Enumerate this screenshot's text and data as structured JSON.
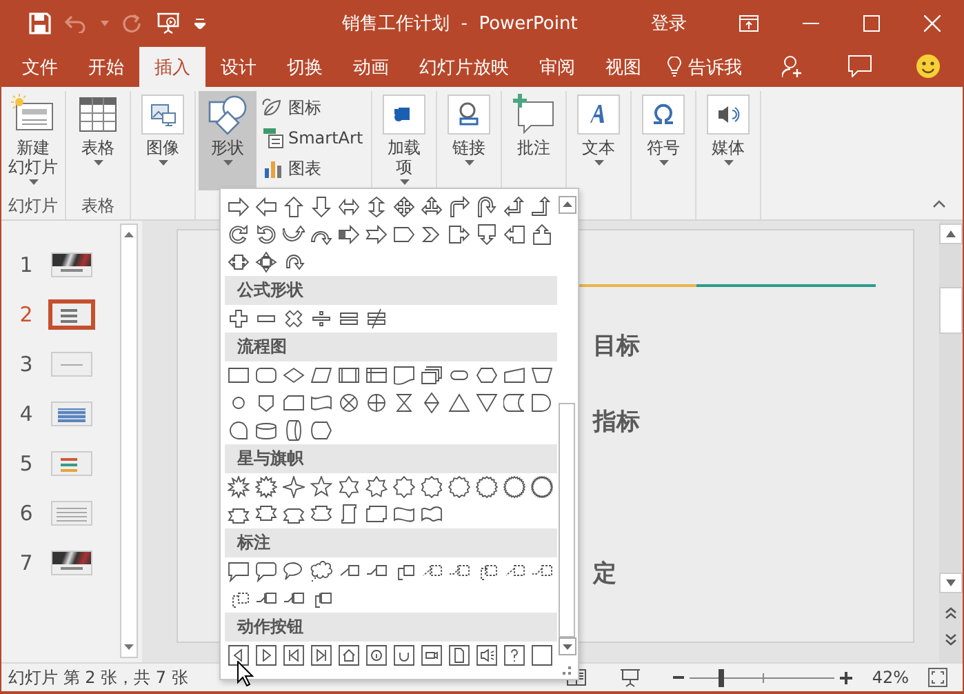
{
  "window": {
    "title": "销售工作计划  -  PowerPoint",
    "sign_in": "登录"
  },
  "tabs": [
    {
      "label": "文件",
      "selected": false
    },
    {
      "label": "开始",
      "selected": false
    },
    {
      "label": "插入",
      "selected": true
    },
    {
      "label": "设计",
      "selected": false
    },
    {
      "label": "切换",
      "selected": false
    },
    {
      "label": "动画",
      "selected": false
    },
    {
      "label": "幻灯片放映",
      "selected": false
    },
    {
      "label": "审阅",
      "selected": false
    },
    {
      "label": "视图",
      "selected": false
    }
  ],
  "tell_me": "告诉我",
  "ribbon": {
    "groups": [
      {
        "label": "幻灯片",
        "buttons": [
          {
            "kind": "newslide",
            "label": [
              "新建",
              "幻灯片"
            ],
            "dropdown": true,
            "pressed": false
          }
        ]
      },
      {
        "label": "表格",
        "buttons": [
          {
            "kind": "table",
            "label": [
              "表格"
            ],
            "dropdown": true,
            "pressed": false
          }
        ]
      },
      {
        "buttons": [
          {
            "kind": "images",
            "label": [
              "图像"
            ],
            "dropdown": true,
            "pressed": false
          }
        ]
      },
      {
        "buttons": [
          {
            "kind": "shapes",
            "label": [
              "形状"
            ],
            "dropdown": true,
            "pressed": true
          }
        ],
        "stack": [
          {
            "kind": "icons",
            "label": "图标"
          },
          {
            "kind": "smartart",
            "label": "SmartArt"
          },
          {
            "kind": "chart",
            "label": "图表"
          }
        ]
      },
      {
        "buttons": [
          {
            "kind": "addins",
            "label": [
              "加载",
              "项"
            ],
            "dropdown": true,
            "pressed": false
          }
        ]
      },
      {
        "buttons": [
          {
            "kind": "links",
            "label": [
              "链接"
            ],
            "dropdown": true,
            "pressed": false
          }
        ]
      },
      {
        "buttons": [
          {
            "kind": "comment",
            "label": [
              "批注"
            ],
            "dropdown": false,
            "pressed": false
          }
        ]
      },
      {
        "buttons": [
          {
            "kind": "text",
            "label": [
              "文本"
            ],
            "dropdown": true,
            "pressed": false
          }
        ]
      },
      {
        "buttons": [
          {
            "kind": "symbols",
            "label": [
              "符号"
            ],
            "dropdown": true,
            "pressed": false
          }
        ]
      },
      {
        "buttons": [
          {
            "kind": "media",
            "label": [
              "媒体"
            ],
            "dropdown": true,
            "pressed": false
          }
        ]
      }
    ]
  },
  "shapes_menu": {
    "sections": [
      {
        "kind": "arrows"
      },
      {
        "kind": "equation",
        "title": "公式形状"
      },
      {
        "kind": "flowchart",
        "title": "流程图"
      },
      {
        "kind": "stars",
        "title": "星与旗帜"
      },
      {
        "kind": "callouts",
        "title": "标注"
      },
      {
        "kind": "action",
        "title": "动作按钮"
      }
    ]
  },
  "slides": [
    {
      "number": "1",
      "selected": false,
      "kind": "photo"
    },
    {
      "number": "2",
      "selected": true,
      "kind": "bullets"
    },
    {
      "number": "3",
      "selected": false,
      "kind": "plain"
    },
    {
      "number": "4",
      "selected": false,
      "kind": "table"
    },
    {
      "number": "5",
      "selected": false,
      "kind": "bars"
    },
    {
      "number": "6",
      "selected": false,
      "kind": "grid"
    },
    {
      "number": "7",
      "selected": false,
      "kind": "photo"
    }
  ],
  "slide": {
    "lines": [
      "目标",
      "指标",
      "定"
    ]
  },
  "status_bar": {
    "slide_info": "幻灯片 第 2 张，共 7 张",
    "zoom": "42%",
    "zoom_slider": {
      "level": 0.22
    }
  }
}
